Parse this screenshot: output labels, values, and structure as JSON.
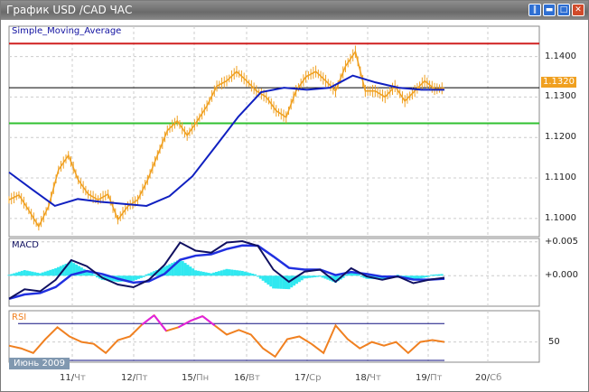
{
  "window": {
    "title": "График USD /CAD  ЧАС",
    "buttons": [
      "tile",
      "minimize",
      "maximize",
      "close"
    ]
  },
  "current_price": "1.1320",
  "month_label": "Июнь 2009",
  "x_axis": [
    {
      "d": "11",
      "w": "Чт"
    },
    {
      "d": "12",
      "w": "Пт"
    },
    {
      "d": "15",
      "w": "Пн"
    },
    {
      "d": "16",
      "w": "Вт"
    },
    {
      "d": "17",
      "w": "Ср"
    },
    {
      "d": "18",
      "w": "Чт"
    },
    {
      "d": "19",
      "w": "Пт"
    },
    {
      "d": "20",
      "w": "Сб"
    }
  ],
  "chart_data": [
    {
      "type": "line",
      "title": "Simple_Moving_Average",
      "symbol": "USD/CAD",
      "timeframe": "H1",
      "ylim": [
        1.0955,
        1.1475
      ],
      "yticks": [
        "1.1400",
        "1.1300",
        "1.1200",
        "1.1100",
        "1.1000"
      ],
      "hlines": {
        "red": 1.1432,
        "black": 1.1323,
        "green": 1.1235
      },
      "price": [
        1.1046,
        1.1058,
        1.102,
        1.098,
        1.103,
        1.112,
        1.1156,
        1.1095,
        1.106,
        1.1046,
        1.106,
        1.0997,
        1.103,
        1.1046,
        1.1095,
        1.1156,
        1.1217,
        1.1241,
        1.1205,
        1.124,
        1.1278,
        1.1327,
        1.134,
        1.1363,
        1.134,
        1.1315,
        1.13,
        1.1266,
        1.125,
        1.1315,
        1.135,
        1.1363,
        1.134,
        1.1315,
        1.1376,
        1.1412,
        1.1315,
        1.1315,
        1.13,
        1.1327,
        1.129,
        1.1315,
        1.134,
        1.132,
        1.1322
      ],
      "sma": [
        1.1114,
        1.1072,
        1.1031,
        1.1048,
        1.1041,
        1.1036,
        1.1031,
        1.1055,
        1.1104,
        1.1177,
        1.1251,
        1.1312,
        1.1323,
        1.1318,
        1.1323,
        1.1353,
        1.1336,
        1.1323,
        1.1318,
        1.1318
      ],
      "colors": {
        "price": "#f0a020",
        "sma": "#1020c0",
        "red": "#d02020",
        "green": "#30c030"
      }
    },
    {
      "type": "line",
      "title": "MACD",
      "ylim": [
        -0.0045,
        0.0055
      ],
      "yticks": [
        "+0.005",
        "+0.000"
      ],
      "macd": [
        -0.0034,
        -0.002,
        -0.0023,
        -0.0006,
        0.0023,
        0.0014,
        -0.0003,
        -0.0013,
        -0.0017,
        -0.0006,
        0.0016,
        0.0049,
        0.0037,
        0.0034,
        0.0049,
        0.0051,
        0.0044,
        0.0009,
        -0.0009,
        0.0006,
        0.0009,
        -0.0009,
        0.0011,
        -0.0001,
        -0.0006,
        -0.0001,
        -0.0011,
        -0.0006,
        -0.0003
      ]
    },
    {
      "type": "line",
      "title": "RSI",
      "ylim": [
        28,
        84
      ],
      "levels": [
        70,
        30
      ],
      "yticks": [
        "50"
      ],
      "rsi": [
        46,
        43,
        38,
        53,
        66,
        56,
        50,
        48,
        38,
        52,
        56,
        69,
        79,
        62,
        66,
        73,
        78,
        68,
        58,
        63,
        58,
        43,
        34,
        53,
        56,
        48,
        38,
        68,
        53,
        43,
        50,
        46,
        50,
        38,
        50,
        52,
        50
      ]
    }
  ]
}
